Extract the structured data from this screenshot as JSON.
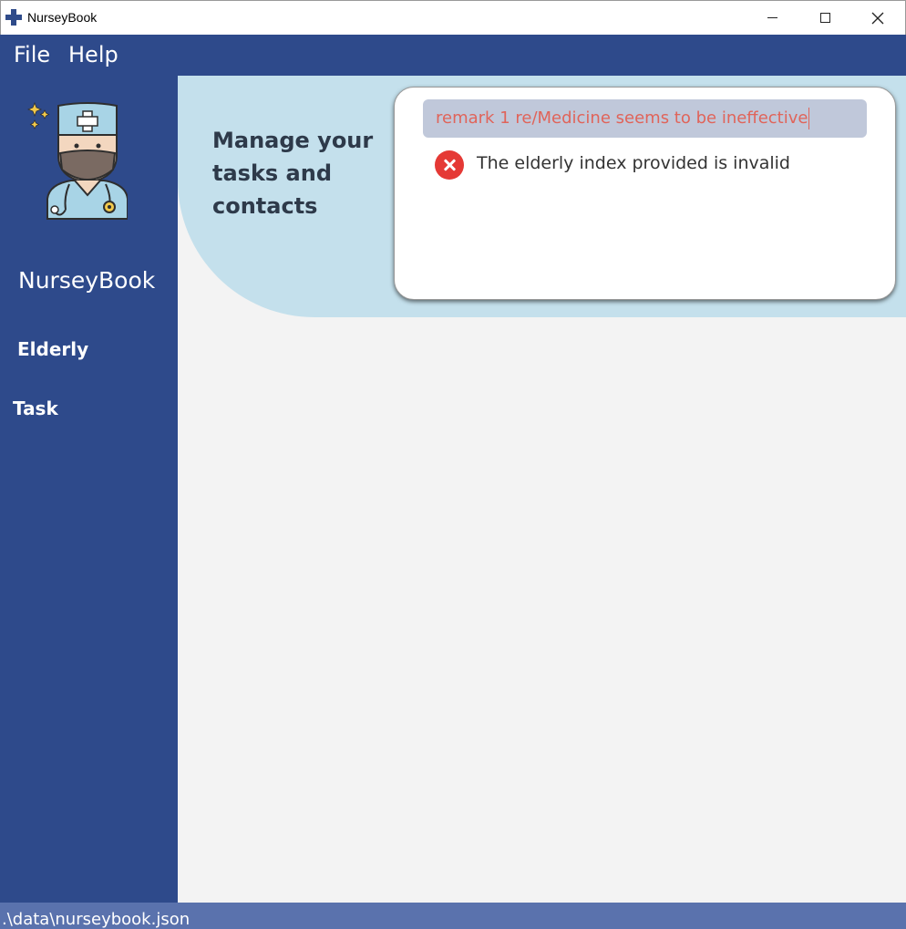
{
  "window": {
    "title": "NurseyBook",
    "icons": {
      "app": "plus-icon",
      "minimize": "minimize-icon",
      "maximize": "maximize-icon",
      "close": "close-icon"
    }
  },
  "menu": {
    "file": "File",
    "help": "Help"
  },
  "sidebar": {
    "avatar_icon": "nurse-avatar-icon",
    "brand": "NurseyBook",
    "items": [
      {
        "label": "Elderly"
      },
      {
        "label": "Task"
      }
    ]
  },
  "header": {
    "tagline": "Manage your tasks and contacts"
  },
  "command": {
    "input_value": "remark 1 re/Medicine seems to be ineffective",
    "result_icon": "error-icon",
    "result_text": "The elderly index provided is invalid"
  },
  "status": {
    "path": ".\\data\\nurseybook.json"
  },
  "colors": {
    "primary": "#2e4a8b",
    "header": "#c4e0ec",
    "error": "#e53935",
    "input_text": "#e0645a",
    "statusbar": "#5a72ad"
  }
}
